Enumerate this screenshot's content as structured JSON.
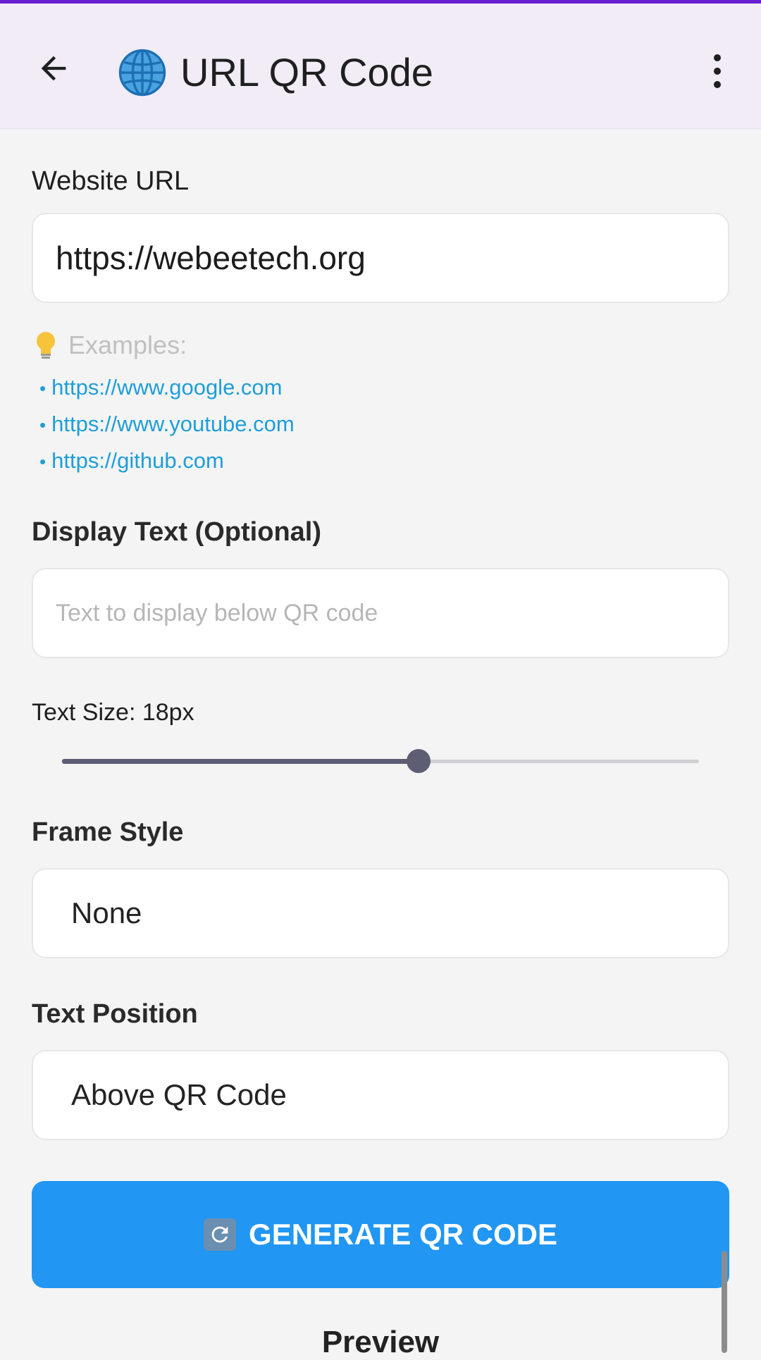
{
  "appbar": {
    "title": "URL QR Code",
    "back_icon": "arrow-left-icon",
    "title_icon": "globe-icon",
    "menu_icon": "more-vert-icon"
  },
  "website_url": {
    "label": "Website URL",
    "value": "https://webeetech.org"
  },
  "examples": {
    "heading": "Examples:",
    "icon": "lightbulb-icon",
    "items": [
      "https://www.google.com",
      "https://www.youtube.com",
      "https://github.com"
    ]
  },
  "display_text": {
    "label": "Display Text (Optional)",
    "placeholder": "Text to display below QR code"
  },
  "text_size": {
    "label": "Text Size: 18px",
    "slider_fraction": 0.56
  },
  "frame_style": {
    "label": "Frame Style",
    "value": "None"
  },
  "text_position": {
    "label": "Text Position",
    "value": "Above QR Code"
  },
  "generate_button": {
    "label": "GENERATE QR CODE",
    "icon": "refresh-icon"
  },
  "preview_heading": "Preview",
  "colors": {
    "accent": "#2196f3",
    "appbar_bg": "#f1ecf6",
    "link": "#1e9ed9",
    "status_line": "#6a1fd1"
  }
}
